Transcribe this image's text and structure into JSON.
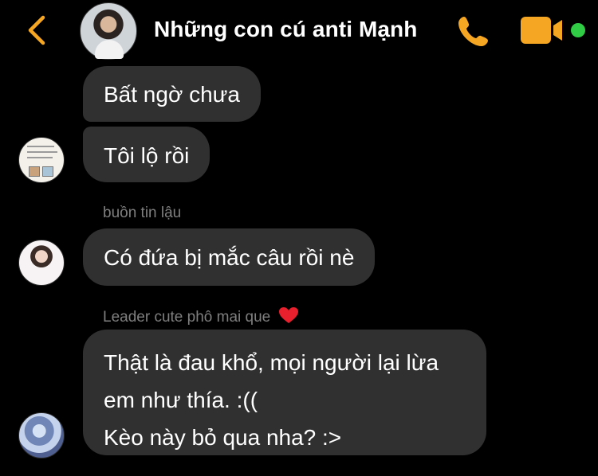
{
  "header": {
    "title": "Những con cú anti Mạnh",
    "accent_color": "#f5a623",
    "online_color": "#31cc46",
    "icons": [
      "back-chevron-icon",
      "phone-icon",
      "video-camera-icon"
    ]
  },
  "messages": [
    {
      "sender": "",
      "text": "Bất ngờ chưa"
    },
    {
      "sender": "",
      "text": "Tôi lộ rồi"
    },
    {
      "sender": "buồn tin lậu",
      "text": "Có đứa bị mắc câu rồi nè"
    },
    {
      "sender": "Leader cute phô mai que",
      "sender_emoji": "heart-icon",
      "lines": [
        "Thật là đau khổ, mọi người lại lừa",
        "em như thía. :((",
        "Kèo này bỏ qua nha? :>"
      ]
    }
  ],
  "colors": {
    "bubble": "#303030",
    "sender_label": "#7f7f7f",
    "heart": "#e8202e"
  }
}
